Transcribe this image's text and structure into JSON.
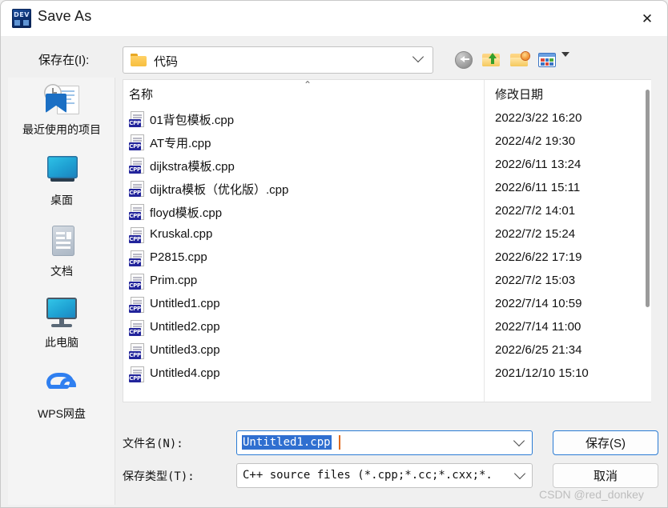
{
  "window": {
    "title": "Save As",
    "app_icon": "devcpp-icon",
    "close_label": "✕"
  },
  "toolbar": {
    "lookin_label": "保存在(I):",
    "current_folder": "代码",
    "buttons": [
      {
        "name": "back-button",
        "icon": "back-arrow-icon"
      },
      {
        "name": "up-one-level-button",
        "icon": "folder-up-icon"
      },
      {
        "name": "create-new-folder-button",
        "icon": "folder-new-icon"
      },
      {
        "name": "views-button",
        "icon": "views-grid-icon"
      }
    ]
  },
  "places": {
    "items": [
      {
        "label": "最近使用的项目",
        "icon": "recent-items-icon"
      },
      {
        "label": "桌面",
        "icon": "desktop-icon"
      },
      {
        "label": "文档",
        "icon": "documents-icon"
      },
      {
        "label": "此电脑",
        "icon": "this-pc-icon"
      },
      {
        "label": "WPS网盘",
        "icon": "wps-cloud-icon"
      }
    ]
  },
  "filelist": {
    "columns": {
      "name": "名称",
      "date_modified": "修改日期"
    },
    "sort_caret": "⌃",
    "rows": [
      {
        "name": "01背包模板.cpp",
        "date": "2022/3/22 16:20",
        "icon": "cpp-file-icon",
        "badge": "CPP"
      },
      {
        "name": "AT专用.cpp",
        "date": "2022/4/2 19:30",
        "icon": "cpp-file-icon",
        "badge": "CPP"
      },
      {
        "name": "dijkstra模板.cpp",
        "date": "2022/6/11 13:24",
        "icon": "cpp-file-icon",
        "badge": "CPP"
      },
      {
        "name": "dijktra模板（优化版）.cpp",
        "date": "2022/6/11 15:11",
        "icon": "cpp-file-icon",
        "badge": "CPP"
      },
      {
        "name": "floyd模板.cpp",
        "date": "2022/7/2 14:01",
        "icon": "cpp-file-icon",
        "badge": "CPP"
      },
      {
        "name": "Kruskal.cpp",
        "date": "2022/7/2 15:24",
        "icon": "cpp-file-icon",
        "badge": "CPP"
      },
      {
        "name": "P2815.cpp",
        "date": "2022/6/22 17:19",
        "icon": "cpp-file-icon",
        "badge": "CPP"
      },
      {
        "name": "Prim.cpp",
        "date": "2022/7/2 15:03",
        "icon": "cpp-file-icon",
        "badge": "CPP"
      },
      {
        "name": "Untitled1.cpp",
        "date": "2022/7/14 10:59",
        "icon": "cpp-file-icon",
        "badge": "CPP"
      },
      {
        "name": "Untitled2.cpp",
        "date": "2022/7/14 11:00",
        "icon": "cpp-file-icon",
        "badge": "CPP"
      },
      {
        "name": "Untitled3.cpp",
        "date": "2022/6/25 21:34",
        "icon": "cpp-file-icon",
        "badge": "CPP"
      },
      {
        "name": "Untitled4.cpp",
        "date": "2021/12/10 15:10",
        "icon": "cpp-file-icon",
        "badge": "CPP"
      }
    ]
  },
  "form": {
    "filename_label": "文件名(N):",
    "filename_value": "Untitled1.cpp",
    "filetype_label": "保存类型(T):",
    "filetype_value": "C++ source files (*.cpp;*.cc;*.cxx;*."
  },
  "actions": {
    "save_label": "保存(S)",
    "cancel_label": "取消"
  },
  "watermark": "CSDN @red_donkey",
  "colors": {
    "accent": "#2a7bd4",
    "selection": "#2f6fd0",
    "caret": "#e06a1e",
    "folder": "#f7bf3e",
    "cpp_badge": "#22249b",
    "cloud": "#2f7ff0"
  }
}
